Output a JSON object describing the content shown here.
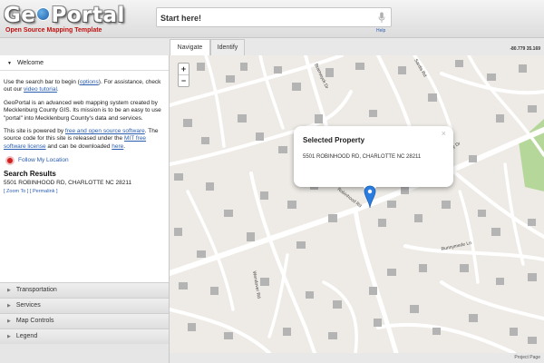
{
  "app": {
    "logo_text_left": "Ge",
    "logo_text_right": "Portal",
    "logo_subtitle": "Open Source Mapping Template"
  },
  "search": {
    "placeholder": "Start here!",
    "help_label": "Help",
    "mic_icon": "microphone-icon"
  },
  "tabs": [
    {
      "label": "Navigate",
      "active": true
    },
    {
      "label": "Identify",
      "active": false
    }
  ],
  "coordinates": "-80.779 35.169",
  "sidebar": {
    "welcome": {
      "header": "Welcome",
      "p1_text": "Use the search bar to begin (",
      "p1_link1": "options",
      "p1_mid": "). For assistance, check out our ",
      "p1_link2": "video tutorial",
      "p1_end": ".",
      "p2": "GeoPortal is an advanced web mapping system created by Mecklenburg County GIS. Its mission is to be an easy to use \"portal\" into Mecklenburg County's data and services.",
      "p3_text": "This site is powered by ",
      "p3_link1": "free and open source software",
      "p3_mid": ". The source code for this site is released under the ",
      "p3_link2": "MIT free software license",
      "p3_mid2": " and can be downloaded ",
      "p3_link3": "here",
      "p3_end": ".",
      "follow_label": "Follow My Location",
      "search_results_title": "Search Results",
      "search_results_address": "5501 ROBINHOOD RD, CHARLOTTE NC 28211",
      "search_results_links": "[ Zoom To ] [ Permalink ]"
    },
    "sections": [
      {
        "label": "Transportation"
      },
      {
        "label": "Services"
      },
      {
        "label": "Map Controls"
      },
      {
        "label": "Legend"
      }
    ]
  },
  "map": {
    "zoom_in": "+",
    "zoom_out": "−",
    "popup": {
      "title": "Selected Property",
      "address": "5501 ROBINHOOD RD, CHARLOTTE NC 28211",
      "close": "×"
    },
    "streets": [
      "Robinhood Rd",
      "Bramwyck Dr",
      "Sardis Rd",
      "Fairway Dr",
      "Runnymede Ln",
      "Wendover Rd"
    ],
    "footer_link": "Project Page",
    "colors": {
      "background": "#eeebe6",
      "road": "#ffffff",
      "building": "#b4b4b4",
      "marker": "#2b7ce0",
      "park": "#b5d89a"
    }
  }
}
